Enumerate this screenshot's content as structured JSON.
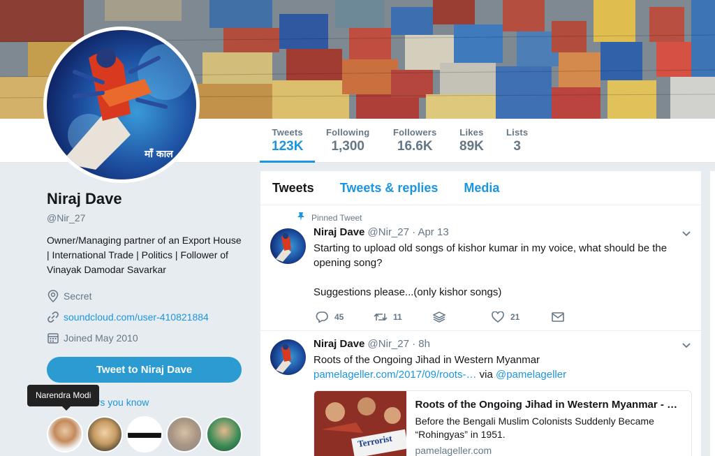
{
  "profile": {
    "name": "Niraj Dave",
    "handle": "@Nir_27",
    "bio": "Owner/Managing partner of an Export House | International Trade | Politics | Follower of Vinayak Damodar Savarkar",
    "location": "Secret",
    "website": "soundcloud.com/user-410821884",
    "joined": "Joined May 2010",
    "tweet_to_label": "Tweet to Niraj Dave",
    "followers_you_know_label": "ers you know",
    "tooltip": "Narendra Modi",
    "avatar_caption": "माँ काल"
  },
  "stats": [
    {
      "label": "Tweets",
      "value": "123K"
    },
    {
      "label": "Following",
      "value": "1,300"
    },
    {
      "label": "Followers",
      "value": "16.6K"
    },
    {
      "label": "Likes",
      "value": "89K"
    },
    {
      "label": "Lists",
      "value": "3"
    }
  ],
  "tabs": [
    {
      "label": "Tweets"
    },
    {
      "label": "Tweets & replies"
    },
    {
      "label": "Media"
    }
  ],
  "tweets": [
    {
      "pinned_label": "Pinned Tweet",
      "name": "Niraj Dave",
      "meta": "@Nir_27 · Apr 13",
      "text1": "Starting to upload old songs of kishor kumar in my voice, what should be the opening song?",
      "text2": "Suggestions please...(only kishor songs)",
      "replies": "45",
      "retweets": "11",
      "likes": "21"
    },
    {
      "name": "Niraj Dave",
      "meta": "@Nir_27 · 8h",
      "text_prefix": "Roots of the Ongoing Jihad in Western Myanmar ",
      "link": "pamelageller.com/2017/09/roots-…",
      "via": " via ",
      "mention": "@pamelageller",
      "card": {
        "title": "Roots of the Ongoing Jihad in Western Myanmar - …",
        "description": "Before the Bengali Muslim Colonists Suddenly Became “Rohingyas” in 1951.",
        "url": "pamelageller.com",
        "image_caption": "Terrorist"
      }
    }
  ],
  "colors": {
    "accent": "#1b95e0",
    "button": "#2b9bd1",
    "muted": "#657786",
    "background": "#e6ecf0"
  }
}
